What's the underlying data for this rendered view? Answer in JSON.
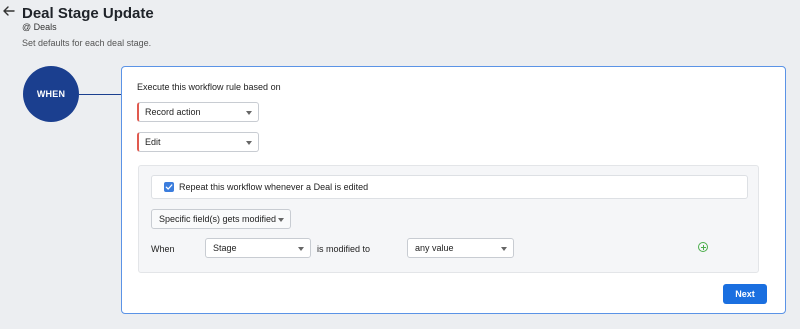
{
  "header": {
    "title": "Deal Stage Update",
    "module": "@ Deals",
    "subtitle": "Set defaults for each deal stage."
  },
  "icons": {
    "back": "arrow-left-icon",
    "caret": "chevron-down-icon",
    "checkbox": "check-icon",
    "add": "plus-circle-icon"
  },
  "colors": {
    "accent": "#1b3f8f",
    "primary_button": "#1a6fe0",
    "required_marker": "#e05a4f",
    "add_icon": "#4cae4c",
    "checkbox": "#3b7ddd"
  },
  "workflow": {
    "when_label": "WHEN",
    "execute_label": "Execute this workflow rule based on",
    "record_action_select": {
      "value": "Record action"
    },
    "action_select": {
      "value": "Edit"
    },
    "repeat": {
      "checked": true,
      "label": "Repeat this workflow whenever a Deal is edited"
    },
    "field_condition_select": {
      "value": "Specific field(s) gets modified"
    },
    "condition_row": {
      "when_text": "When",
      "field_select": {
        "value": "Stage"
      },
      "modified_text": "is modified to",
      "value_select": {
        "value": "any value"
      }
    },
    "next_button": "Next"
  }
}
